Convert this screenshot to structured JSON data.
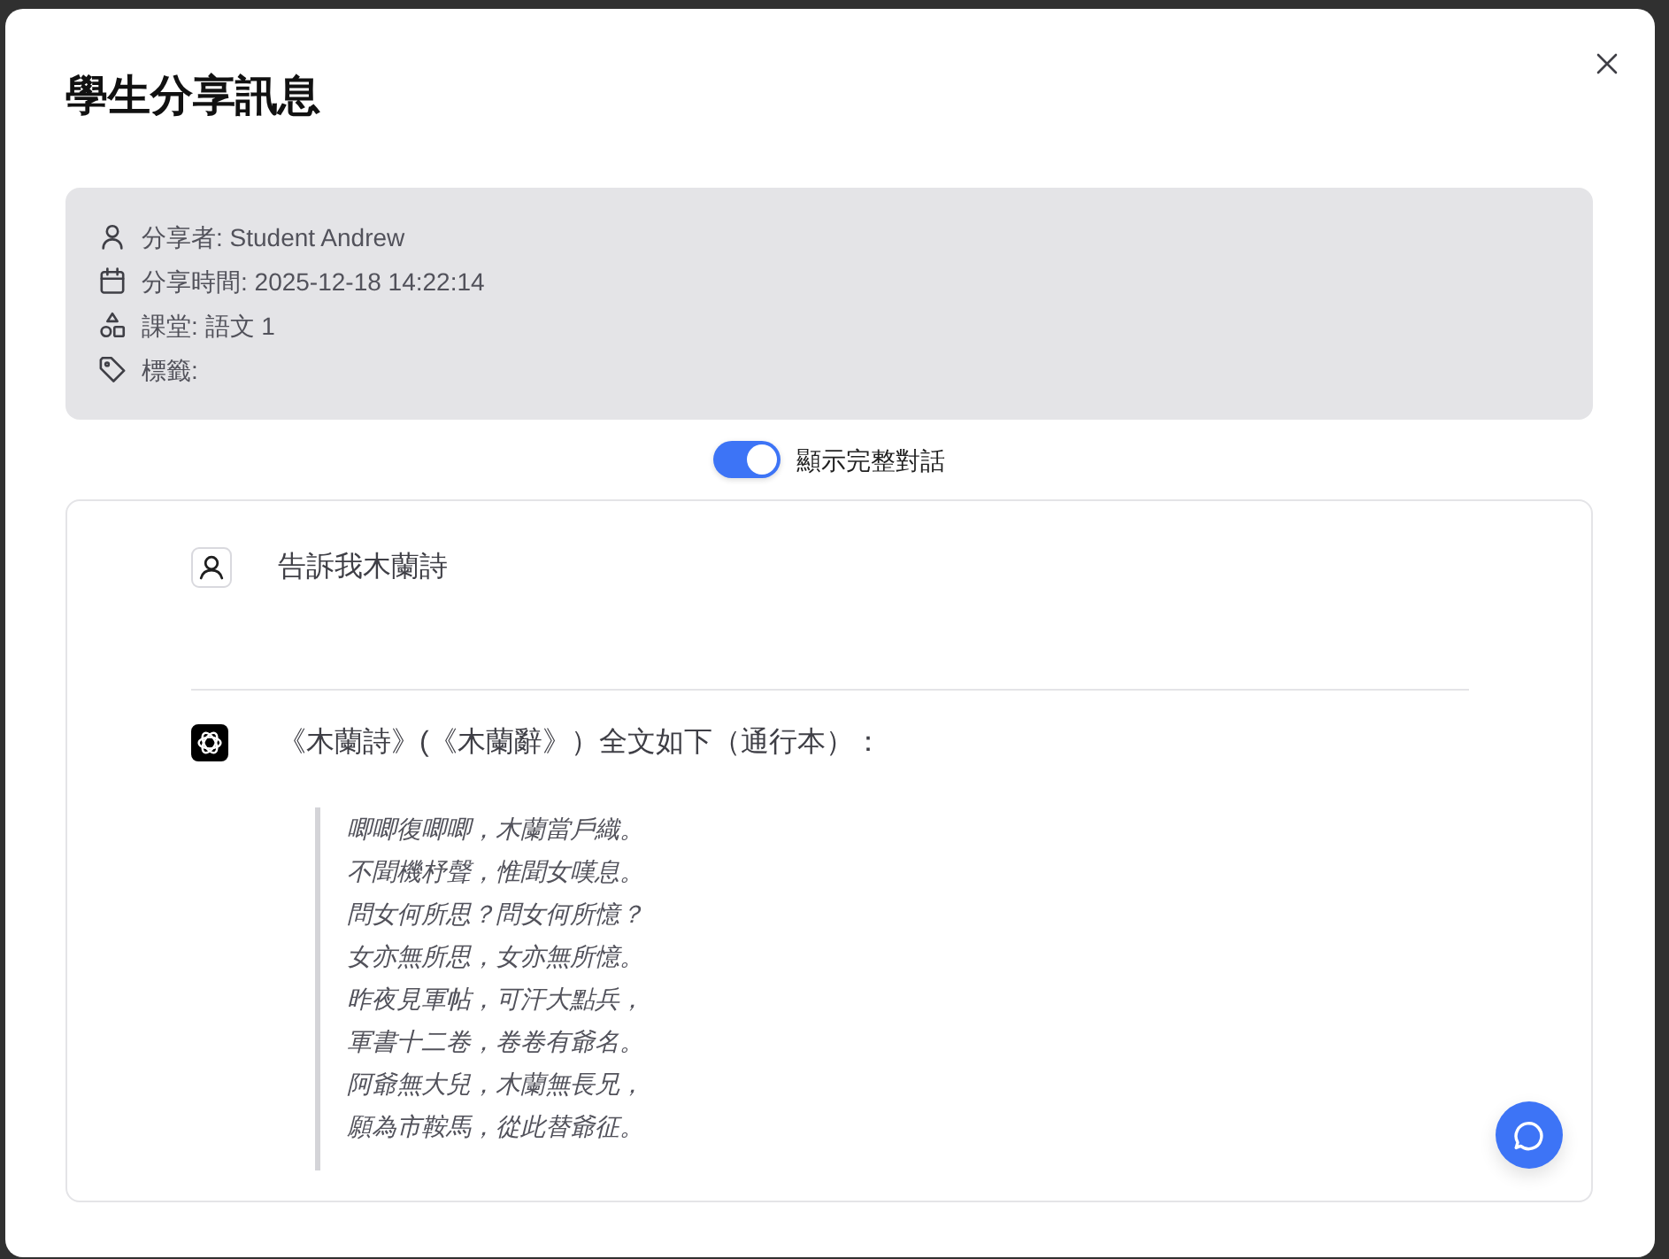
{
  "dialog": {
    "title": "學生分享訊息"
  },
  "info": [
    {
      "kind": "user",
      "text": "分享者: Student Andrew"
    },
    {
      "kind": "calendar",
      "text": "分享時間: 2025-12-18 14:22:14"
    },
    {
      "kind": "classroom",
      "text": "課堂: 語文 1"
    },
    {
      "kind": "tag",
      "text": "標籤:"
    }
  ],
  "toggle": {
    "label": "顯示完整對話",
    "on": true
  },
  "messages": [
    {
      "kind": "user",
      "text": "告訴我木蘭詩"
    },
    {
      "kind": "assistant",
      "text": "《木蘭詩》(《木蘭辭》）全文如下（通行本）：",
      "quote": [
        "唧唧復唧唧，木蘭當戶織。",
        "不聞機杼聲，惟聞女嘆息。",
        "問女何所思？問女何所憶？",
        "女亦無所思，女亦無所憶。",
        "昨夜見軍帖，可汗大點兵，",
        "軍書十二卷，卷卷有爺名。",
        "阿爺無大兒，木蘭無長兄，",
        "願為市鞍馬，從此替爺征。"
      ]
    }
  ]
}
